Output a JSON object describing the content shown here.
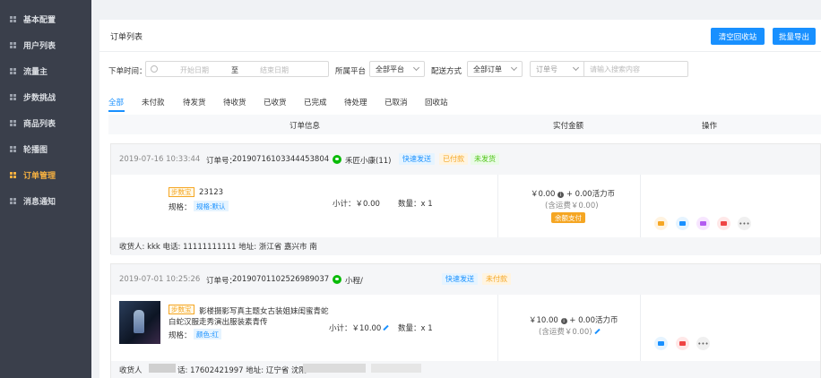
{
  "sidebar": {
    "items": [
      {
        "label": "基本配置",
        "active": false
      },
      {
        "label": "用户列表",
        "active": false
      },
      {
        "label": "流量主",
        "active": false
      },
      {
        "label": "步数挑战",
        "active": false
      },
      {
        "label": "商品列表",
        "active": false
      },
      {
        "label": "轮播图",
        "active": false
      },
      {
        "label": "订单管理",
        "active": true
      },
      {
        "label": "消息通知",
        "active": false
      }
    ]
  },
  "header": {
    "title": "订单列表",
    "clear_recycle_label": "清空回收站",
    "batch_export_label": "批量导出"
  },
  "filters": {
    "time_label": "下单时间：",
    "start_placeholder": "开始日期",
    "range_sep": "至",
    "end_placeholder": "结束日期",
    "platform_label": "所属平台",
    "platform_value": "全部平台",
    "delivery_label": "配送方式",
    "delivery_value": "全部订单",
    "search_field_value": "订单号",
    "search_placeholder": "请输入搜索内容"
  },
  "tabs": [
    {
      "label": "全部",
      "active": true
    },
    {
      "label": "未付款"
    },
    {
      "label": "待发货"
    },
    {
      "label": "待收货"
    },
    {
      "label": "已收货"
    },
    {
      "label": "已完成"
    },
    {
      "label": "待处理"
    },
    {
      "label": "已取消"
    },
    {
      "label": "回收站"
    }
  ],
  "table": {
    "columns": [
      "订单信息",
      "实付金额",
      "操作"
    ]
  },
  "orders": [
    {
      "datetime": "2019-07-16 10:33:44",
      "order_no_label": "订单号：",
      "order_no": "20190716103344453804",
      "buyer": "禾匠小康(11)",
      "tags": [
        "快速发送",
        "已付款",
        "未发货"
      ],
      "badge": "步数宝",
      "product_name": "23123",
      "spec_label": "规格：",
      "spec": "规格:默认",
      "subtotal": "小计：￥0.00",
      "quantity": "数量：x 1",
      "amount": "￥0.00",
      "points": "+ 0.00活力币",
      "shipping": "(含运费￥0.00)",
      "pay_method": "余额支付",
      "address": "收货人: kkk 电话: 11111111111 地址: 浙江省 嘉兴市 南"
    },
    {
      "datetime": "2019-07-01 10:25:26",
      "order_no_label": "订单号：",
      "order_no": "20190701102526989037",
      "buyer": "小程/",
      "tags": [
        "快速发送",
        "未付款"
      ],
      "badge": "步数宝",
      "product_name_line1": "影楼摄影写真主题女古装姐妹闺蜜青蛇",
      "product_name_line2": "白蛇汉服走秀演出服装素青传",
      "spec_label": "规格：",
      "spec": "颜色:红",
      "subtotal": "小计：￥10.00",
      "quantity": "数量：x 1",
      "amount": "￥10.00",
      "points": "+ 0.00活力币",
      "shipping": "(含运费￥0.00)",
      "address_prefix": "收货人",
      "address": "话: 17602421997 地址: 辽宁省 沈阳"
    }
  ],
  "colors": {
    "accent": "#1890ff",
    "sidebar_bg": "#3a3f4b",
    "active_nav": "#f5b041"
  }
}
